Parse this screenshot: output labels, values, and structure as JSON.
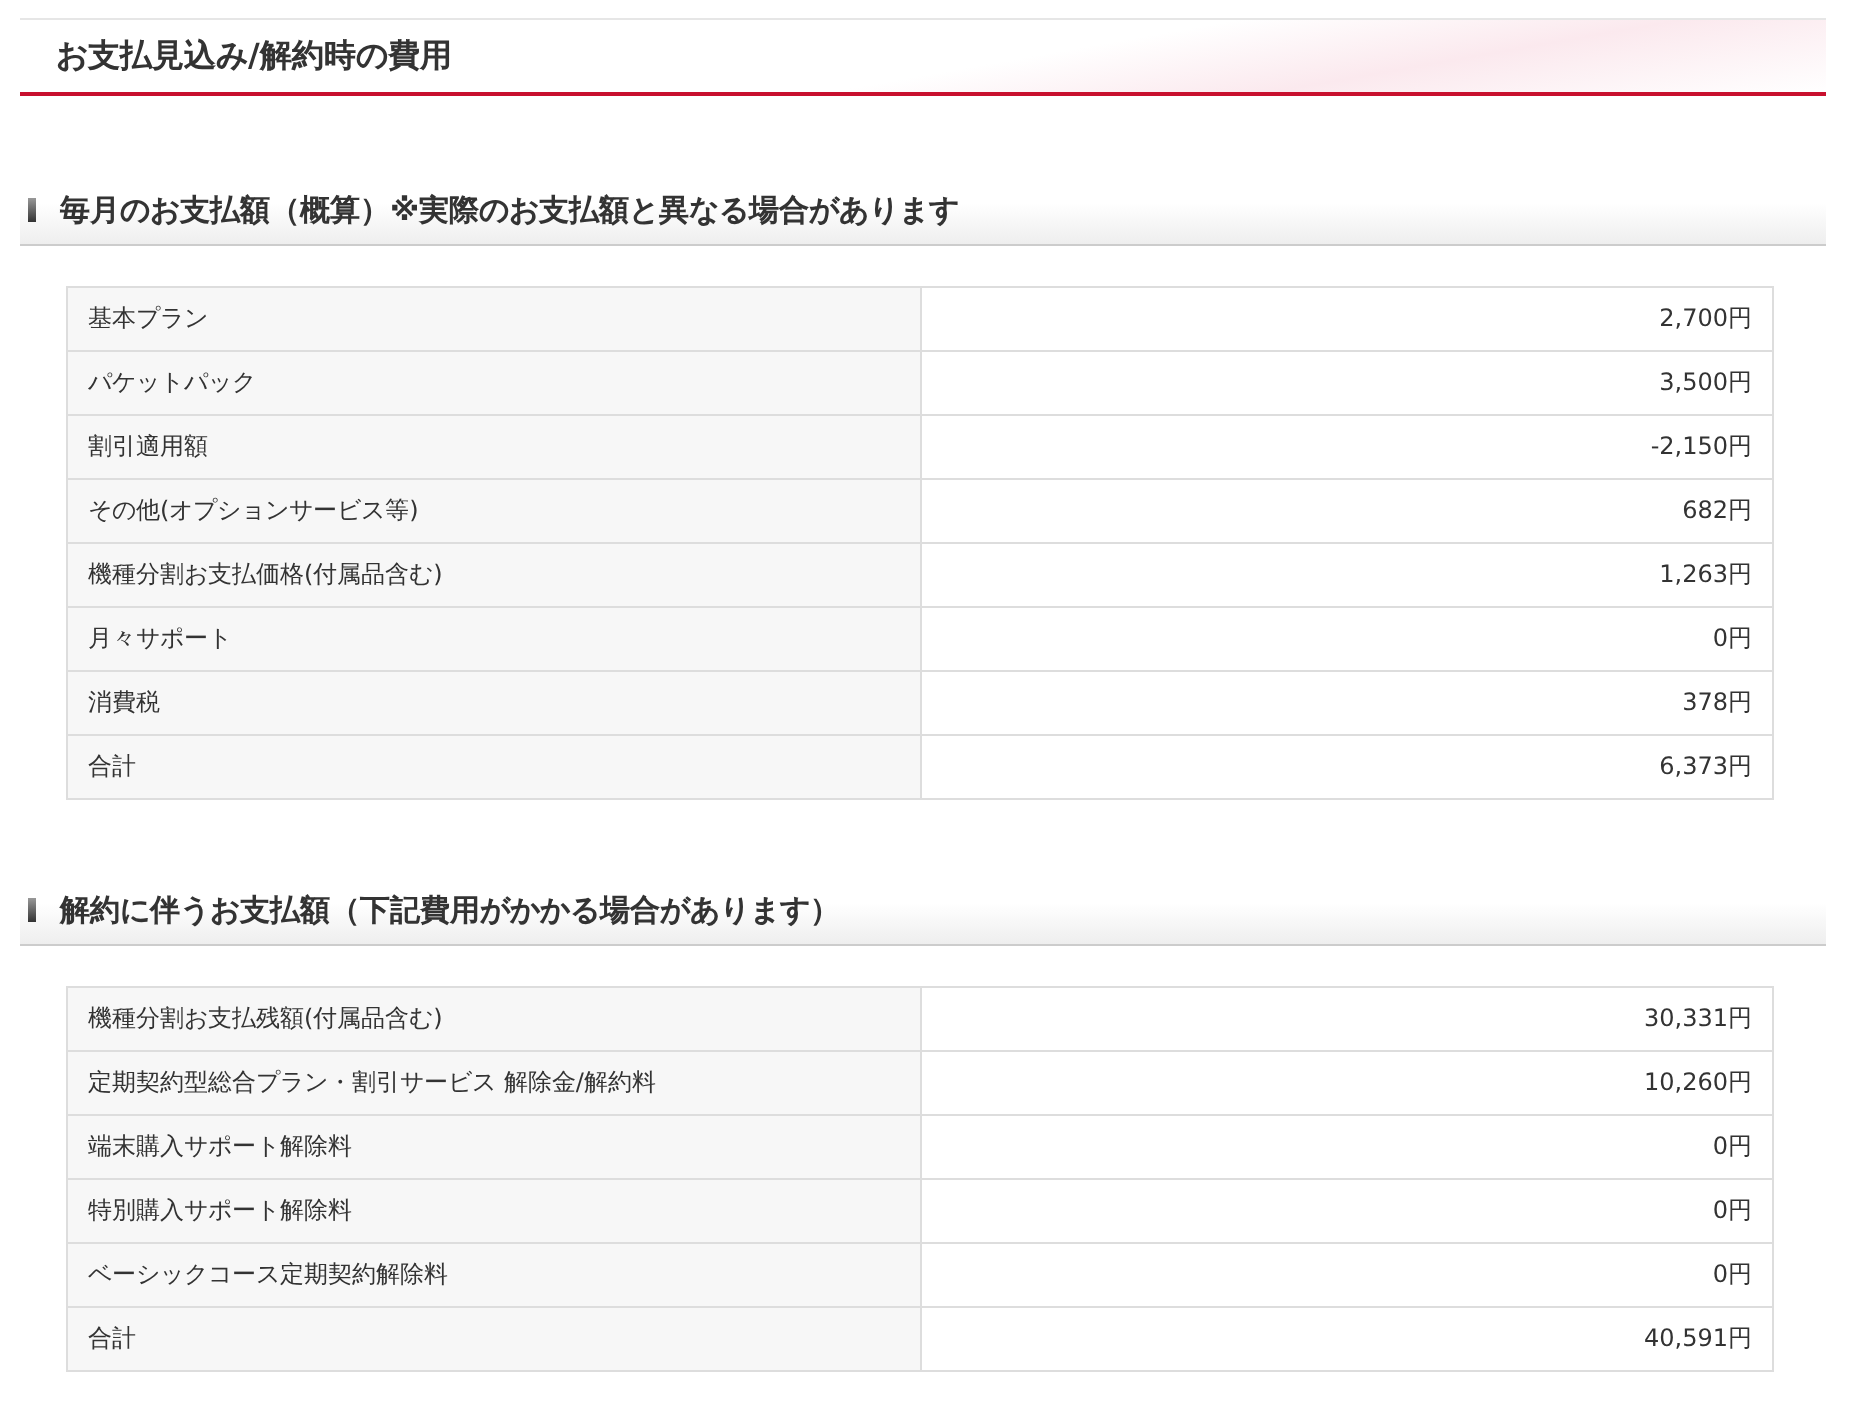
{
  "page_title": "お支払見込み/解約時の費用",
  "sections": [
    {
      "heading": "毎月のお支払額（概算）※実際のお支払額と異なる場合があります",
      "rows": [
        {
          "label": "基本プラン",
          "amount": "2,700円"
        },
        {
          "label": "パケットパック",
          "amount": "3,500円"
        },
        {
          "label": "割引適用額",
          "amount": "-2,150円"
        },
        {
          "label": "その他(オプションサービス等)",
          "amount": "682円"
        },
        {
          "label": "機種分割お支払価格(付属品含む)",
          "amount": "1,263円"
        },
        {
          "label": "月々サポート",
          "amount": "0円"
        },
        {
          "label": "消費税",
          "amount": "378円"
        },
        {
          "label": "合計",
          "amount": "6,373円"
        }
      ]
    },
    {
      "heading": "解約に伴うお支払額（下記費用がかかる場合があります）",
      "rows": [
        {
          "label": "機種分割お支払残額(付属品含む)",
          "amount": "30,331円"
        },
        {
          "label": "定期契約型総合プラン・割引サービス 解除金/解約料",
          "amount": "10,260円"
        },
        {
          "label": "端末購入サポート解除料",
          "amount": "0円"
        },
        {
          "label": "特別購入サポート解除料",
          "amount": "0円"
        },
        {
          "label": "ベーシックコース定期契約解除料",
          "amount": "0円"
        },
        {
          "label": "合計",
          "amount": "40,591円"
        }
      ]
    }
  ]
}
